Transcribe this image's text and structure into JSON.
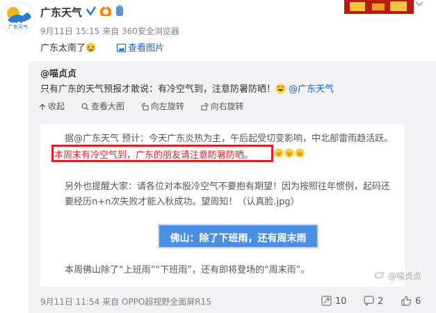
{
  "post": {
    "username": "广东天气",
    "avatar_caption": "广东天气",
    "meta": "9月11日 15:15 来自 360安全浏览器",
    "text": "广东太南了",
    "view_pictures": "查看图片"
  },
  "repost": {
    "author": "@喵贞贞",
    "text": "只有广东的天气预报才敢说：有冷空气到，注意防暑防晒！",
    "mention": "@广东天气",
    "toolbar": {
      "collapse": "收起",
      "view_large": "查看大图",
      "rotate_left": "向左旋转",
      "rotate_right": "向右旋转"
    },
    "picture": {
      "line1_prefix": "据",
      "line1_mention": "@广东天气",
      "line1_rest": " 预计：今天广东炎热为主，午后起受切变影响，中北部雷雨趋活跃。",
      "highlight": "本周末有冷空气到，广东的朋友请注意防暑防晒。",
      "para2_line1": "另外也提醒大家：请各位对本股冷空气不要抱有期望！因为按照往年惯例，起码还",
      "para2_line2": "要经历n+n次失败才能入秋成功。望周知！（认真脸.jpg）",
      "banner": "佛山：除了下班雨，还有周末雨",
      "para3": "本周佛山除了“上班雨”“下班雨”，还有即将登场的“周末雨”。",
      "watermark": "@喵贞贞"
    },
    "footer": {
      "meta": "9月11日 11:54 来自 OPPO超视野全面屏R15",
      "reposts": "10",
      "comments": "2",
      "likes": "6"
    }
  },
  "colors": {
    "link": "#1a60b8",
    "highlight_border": "#e02020",
    "banner": "#4a90e2"
  }
}
